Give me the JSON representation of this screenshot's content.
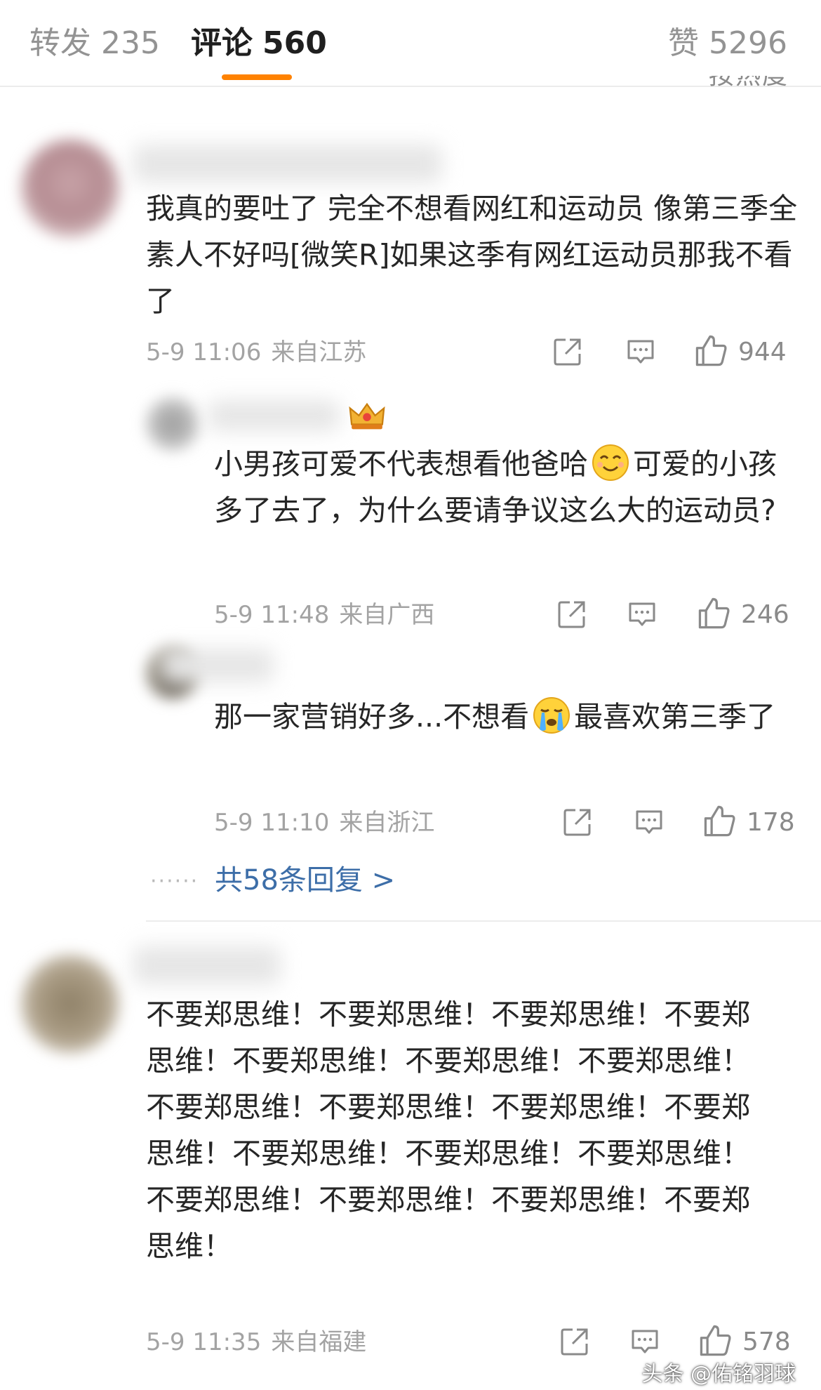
{
  "tabs": {
    "repost": {
      "label": "转发",
      "count": "235"
    },
    "comments": {
      "label": "评论",
      "count": "560"
    },
    "likes": {
      "label": "赞",
      "count": "5296"
    }
  },
  "sort_hint": "按热度",
  "comments": [
    {
      "text": "我真的要吐了 完全不想看网红和运动员 像第三季全素人不好吗[微笑R]如果这季有网红运动员那我不看了",
      "date": "5-9 11:06",
      "location": "来自江苏",
      "likes": "944",
      "replies": [
        {
          "text_before": "小男孩可爱不代表想看他爸哈",
          "emoji": "smile-face",
          "text_after": "可爱的小孩多了去了，为什么要请争议这么大的运动员?",
          "date": "5-9 11:48",
          "location": "来自广西",
          "likes": "246",
          "badge_icon": "crown-icon"
        },
        {
          "text_before": "那一家营销好多...不想看",
          "emoji": "crying-face",
          "text_after": "最喜欢第三季了",
          "date": "5-9 11:10",
          "location": "来自浙江",
          "likes": "178"
        }
      ],
      "more_dots": "······",
      "more_replies": "共58条回复 >"
    },
    {
      "text": "不要郑思维！不要郑思维！不要郑思维！不要郑思维！不要郑思维！不要郑思维！不要郑思维！不要郑思维！不要郑思维！不要郑思维！不要郑思维！不要郑思维！不要郑思维！不要郑思维！不要郑思维！不要郑思维！不要郑思维！不要郑思维！",
      "date": "5-9 11:35",
      "location": "来自福建",
      "likes": "578"
    }
  ],
  "watermark": "头条 @佑铭羽球",
  "colors": {
    "accent": "#ff8200",
    "link": "#3d6ea8",
    "meta": "#a3a3a3"
  }
}
